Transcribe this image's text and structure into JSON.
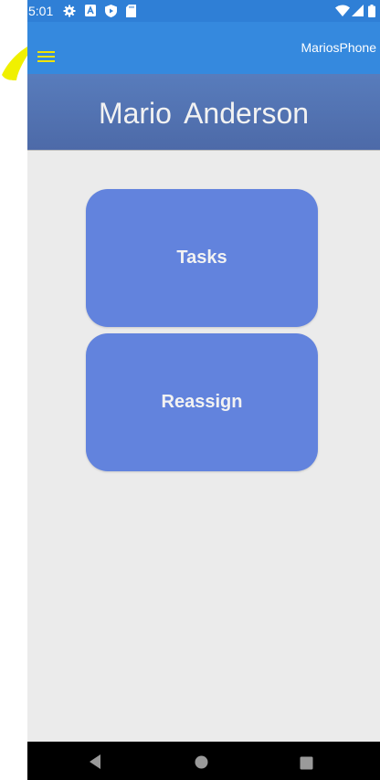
{
  "status_bar": {
    "time": "5:01",
    "left_icons": [
      "gear-icon",
      "a-icon",
      "play-protect-icon",
      "sd-card-icon"
    ],
    "right_icons": [
      "wifi-icon",
      "signal-icon",
      "battery-icon"
    ]
  },
  "app_bar": {
    "menu_icon": "hamburger-menu-icon",
    "device_name": "MariosPhone"
  },
  "header": {
    "user_name": "Mario  Anderson"
  },
  "tiles": [
    {
      "label": "Tasks"
    },
    {
      "label": "Reassign"
    }
  ],
  "nav_bar": {
    "buttons": [
      "back-icon",
      "home-icon",
      "recents-icon"
    ]
  },
  "colors": {
    "status_bar": "#2f7fd6",
    "app_bar": "#3589de",
    "header": "#587cbc",
    "tile": "#6283dd",
    "background": "#ebebeb",
    "menu_icon": "#f0e400"
  }
}
